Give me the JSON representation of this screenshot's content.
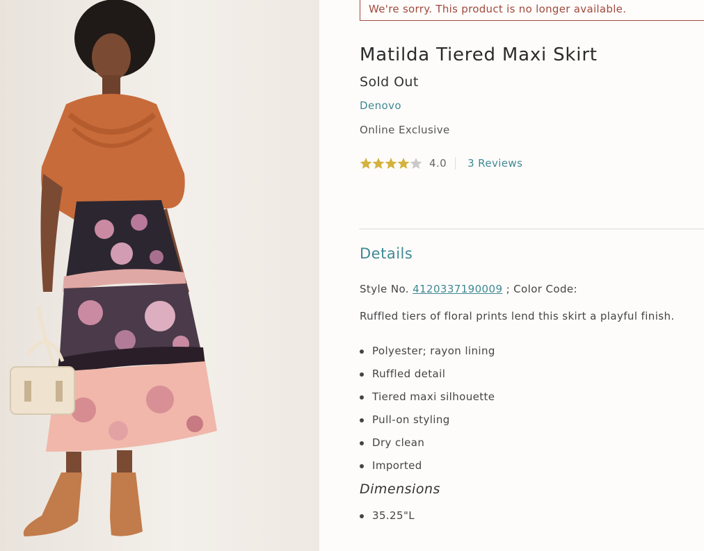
{
  "alert": {
    "message": "We're sorry. This product is no longer available."
  },
  "product": {
    "title": "Matilda Tiered Maxi Skirt",
    "status": "Sold Out",
    "brand": "Denovo",
    "exclusive": "Online Exclusive",
    "rating": {
      "value": "4.0",
      "stars": 4,
      "max": 5,
      "reviews": "3 Reviews"
    }
  },
  "details": {
    "heading": "Details",
    "style_label": "Style No.",
    "style_number": "4120337190009",
    "color_code_label": "; Color Code:",
    "description": "Ruffled tiers of floral prints lend this skirt a playful finish.",
    "features": [
      "Polyester; rayon lining",
      "Ruffled detail",
      "Tiered maxi silhouette",
      "Pull-on styling",
      "Dry clean",
      "Imported"
    ],
    "dimensions_heading": "Dimensions",
    "dimensions": [
      "35.25\"L"
    ]
  },
  "colors": {
    "accent": "#3f8893",
    "alert": "#a0483a",
    "star": "#d4b23c",
    "star_empty": "#c9c9c9"
  }
}
